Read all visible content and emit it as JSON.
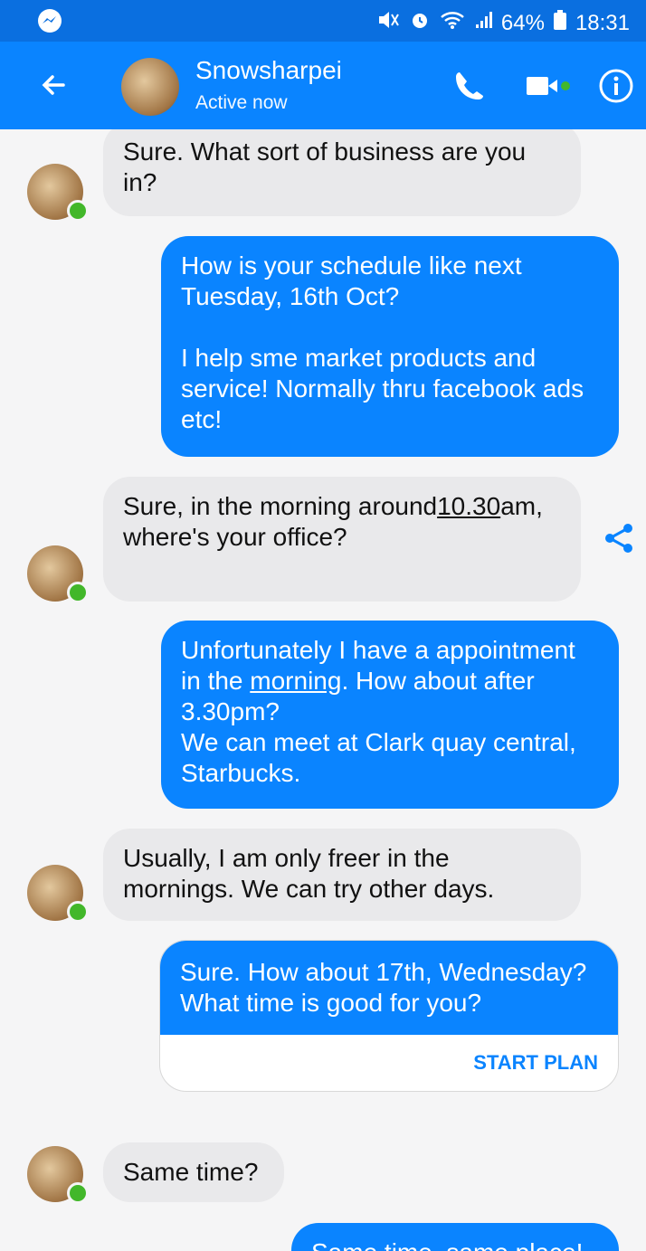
{
  "status_bar": {
    "battery": "64%",
    "time": "18:31"
  },
  "header": {
    "contact_name": "Snowsharpei",
    "contact_status": "Active now"
  },
  "messages": [
    {
      "dir": "in",
      "text": "Sure. What sort of business are you in?"
    },
    {
      "dir": "out",
      "text": "How is your schedule like next Tuesday, 16th Oct?\n\nI help sme market products and service! Normally thru facebook ads etc!"
    },
    {
      "dir": "in",
      "text_a": "Sure, in the morning around",
      "text_link": "10.30",
      "text_b": "am, where's your office?"
    },
    {
      "dir": "out",
      "text_a": "Unfortunately I have a appointment in the ",
      "text_link": "morning",
      "text_b": ". How about after 3.30pm?\nWe can meet at Clark quay central, Starbucks."
    },
    {
      "dir": "in",
      "text": "Usually, I am only freer in the mornings. We can try other days."
    },
    {
      "dir": "out",
      "text": "Sure. How about 17th, Wednesday?  What time is good for you?",
      "action_label": "START PLAN"
    },
    {
      "dir": "in",
      "text": "Same time?"
    },
    {
      "dir": "out",
      "text": "Same time, same place!"
    }
  ],
  "colors": {
    "brand_blue": "#0a84ff",
    "status_bar_blue": "#0a6fe0",
    "incoming_bubble": "#e9e9eb",
    "active_green": "#42b72a"
  }
}
